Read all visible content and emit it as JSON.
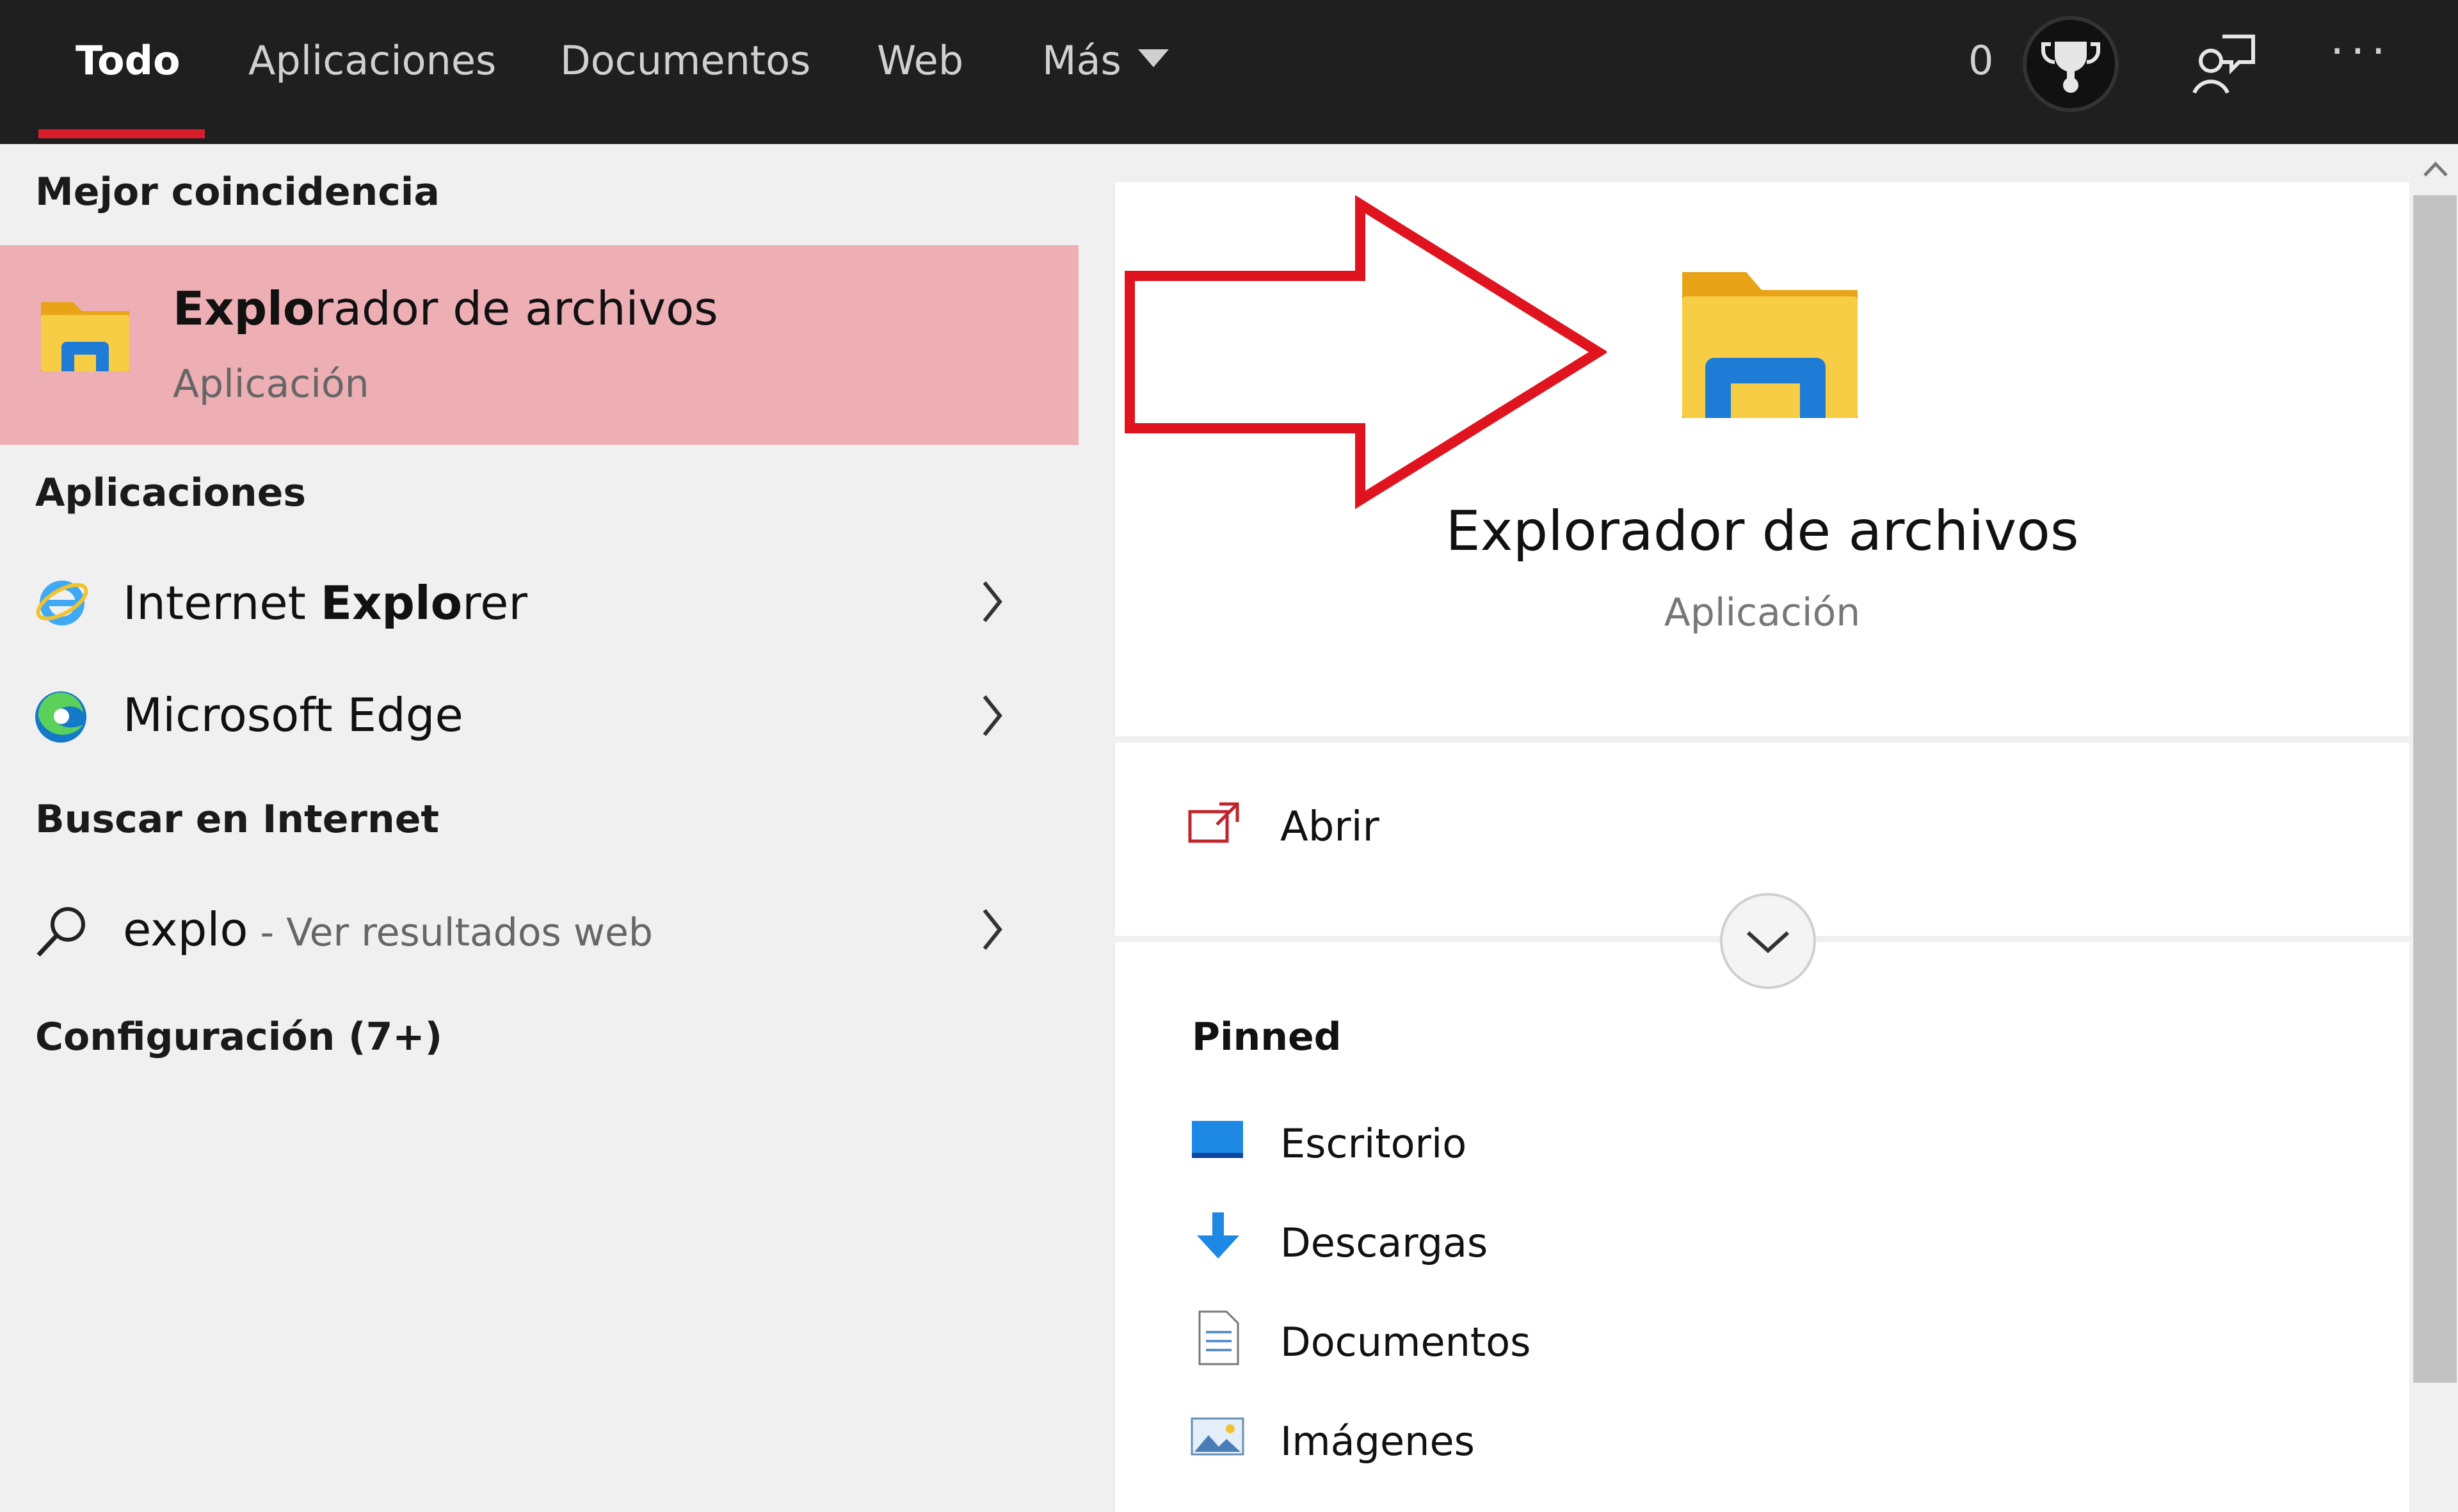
{
  "tabs": [
    {
      "label": "Todo"
    },
    {
      "label": "Aplicaciones"
    },
    {
      "label": "Documentos"
    },
    {
      "label": "Web"
    },
    {
      "label": "Más"
    }
  ],
  "header": {
    "points": "0",
    "more": "···"
  },
  "left": {
    "best_match_heading": "Mejor coincidencia",
    "best_match": {
      "title_bold": "Explo",
      "title_rest": "rador de archivos",
      "subtitle": "Aplicación"
    },
    "apps_heading": "Aplicaciones",
    "apps": [
      {
        "pre": "Internet ",
        "bold": "Explo",
        "post": "rer"
      },
      {
        "pre": "Microsoft Edge",
        "bold": "",
        "post": ""
      }
    ],
    "web_heading": "Buscar en Internet",
    "web_result": {
      "query": "explo",
      "hint": " - Ver resultados web"
    },
    "settings_heading": "Configuración (7+)"
  },
  "right": {
    "title": "Explorador de archivos",
    "subtitle": "Aplicación",
    "open_label": "Abrir",
    "pinned_heading": "Pinned",
    "pinned": [
      {
        "label": "Escritorio",
        "icon": "desktop-icon"
      },
      {
        "label": "Descargas",
        "icon": "downloads-icon"
      },
      {
        "label": "Documentos",
        "icon": "documents-icon"
      },
      {
        "label": "Imágenes",
        "icon": "pictures-icon"
      }
    ]
  },
  "colors": {
    "accent": "#d81e2a",
    "highlight": "#edaeb4",
    "topbar": "#1f1f1f",
    "annotation_arrow": "#e0141e"
  }
}
